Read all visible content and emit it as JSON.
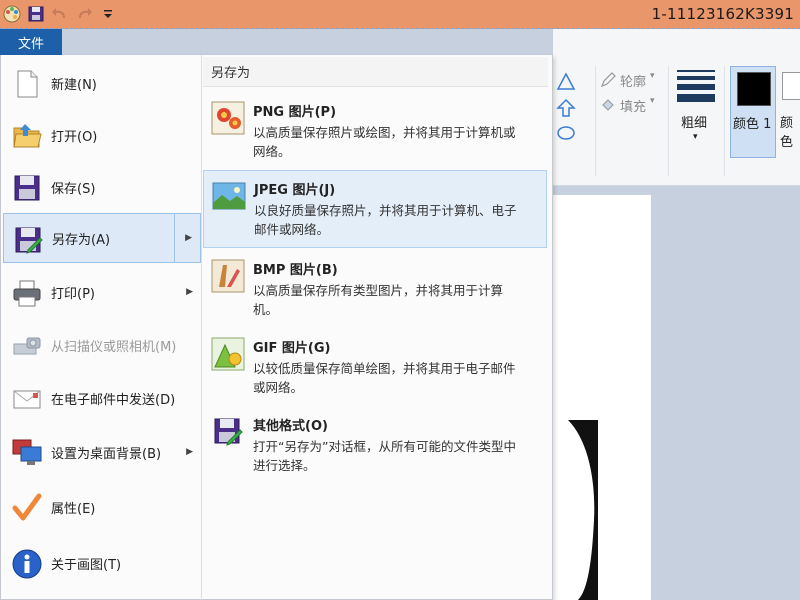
{
  "titlebar": {
    "title": "1-11123162K3391"
  },
  "file_tab": {
    "label": "文件"
  },
  "left_menu": [
    {
      "label": "新建(N)",
      "icon": "new-doc-icon"
    },
    {
      "label": "打开(O)",
      "icon": "open-folder-icon"
    },
    {
      "label": "保存(S)",
      "icon": "save-icon"
    },
    {
      "label": "另存为(A)",
      "icon": "save-as-icon"
    },
    {
      "label": "打印(P)",
      "icon": "printer-icon"
    },
    {
      "label": "从扫描仪或照相机(M)",
      "icon": "scanner-icon"
    },
    {
      "label": "在电子邮件中发送(D)",
      "icon": "email-icon"
    },
    {
      "label": "设置为桌面背景(B)",
      "icon": "desktop-icon"
    },
    {
      "label": "属性(E)",
      "icon": "checkmark-icon"
    },
    {
      "label": "关于画图(T)",
      "icon": "info-icon"
    }
  ],
  "save_as": {
    "heading": "另存为",
    "formats": [
      {
        "name": "PNG 图片(P)",
        "desc": "以高质量保存照片或绘图，并将其用于计算机或网络。"
      },
      {
        "name": "JPEG 图片(J)",
        "desc": "以良好质量保存照片，并将其用于计算机、电子邮件或网络。"
      },
      {
        "name": "BMP 图片(B)",
        "desc": "以高质量保存所有类型图片，并将其用于计算机。"
      },
      {
        "name": "GIF 图片(G)",
        "desc": "以较低质量保存简单绘图，并将其用于电子邮件或网络。"
      },
      {
        "name": "其他格式(O)",
        "desc": "打开“另存为”对话框，从所有可能的文件类型中进行选择。"
      }
    ]
  },
  "ribbon": {
    "outline_label": "轮廓",
    "fill_label": "填充",
    "thickness_label": "粗细",
    "color1_label": "颜色 1",
    "color2_label": "颜色"
  },
  "colors": {
    "titlebar": "#e9966b",
    "file_tab": "#1d5fa8",
    "hover": "#dde9f6",
    "color1_swatch": "#000000"
  }
}
